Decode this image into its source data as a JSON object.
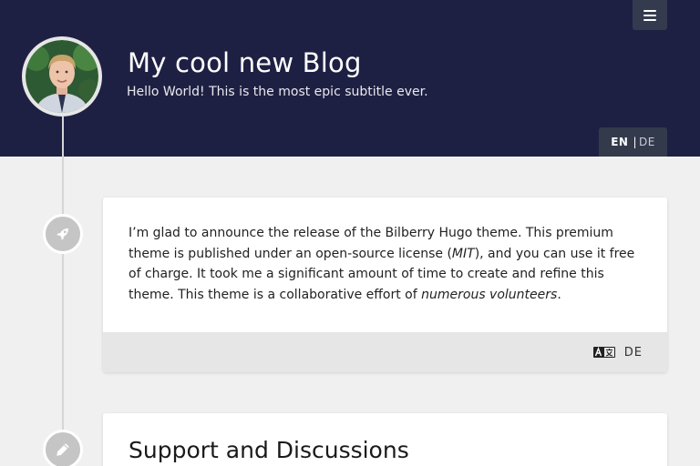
{
  "header": {
    "title": "My cool new Blog",
    "subtitle": "Hello World! This is the most epic subtitle ever.",
    "background": "#1e2043",
    "menu_icon": "hamburger-menu-icon",
    "avatar_alt": "profile photo"
  },
  "language_switch": {
    "active": "EN",
    "separator": "|",
    "other": "DE"
  },
  "timeline_icons": [
    "rocket-icon",
    "pencil-icon"
  ],
  "articles": [
    {
      "text_1": "I’m glad to announce the release of the Bilberry Hugo theme. This premium theme is published under an open-source license (",
      "license": "MIT",
      "text_2": "), and you can use it free of charge. It took me a significant amount of time to create and refine this theme. This theme is a collaborative effort of ",
      "volunteers": "numerous volunteers",
      "text_3": ".",
      "translation_icon": "translate-icon",
      "translation_lang": "DE"
    },
    {
      "title": "Support and Discussions"
    }
  ]
}
